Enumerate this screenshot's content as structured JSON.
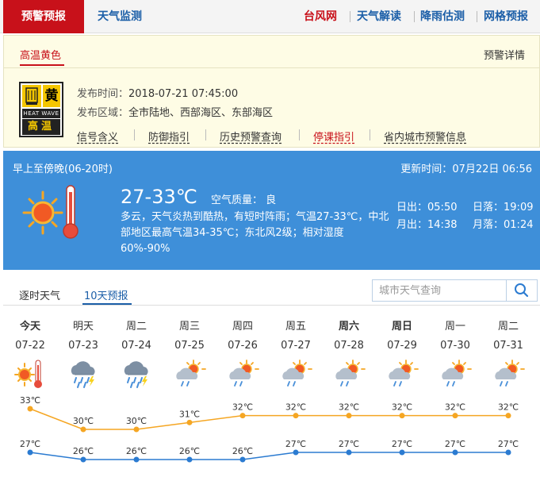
{
  "topbar": {
    "active_tab": "预警预报",
    "monitor_tab": "天气监测",
    "links": [
      "台风网",
      "天气解读",
      "降雨估测",
      "网格预报"
    ],
    "link_colors": [
      "#c8111a",
      "#1c5fa8",
      "#1c5fa8",
      "#1c5fa8"
    ]
  },
  "warning": {
    "title": "高温黄色",
    "detail_link": "预警详情",
    "badge": {
      "char": "黄",
      "en": "HEAT WAVE",
      "cn": "高温",
      "color": "#f4c600"
    },
    "publish_label": "发布时间：",
    "publish_time": "2018-07-21 07:45:00",
    "area_label": "发布区域：",
    "area": "全市陆地、西部海区、东部海区",
    "links": [
      "信号含义",
      "防御指引",
      "历史预警查询",
      "停课指引",
      "省内城市预警信息"
    ]
  },
  "today": {
    "period": "早上至傍晚(06-20时)",
    "update_label": "更新时间：",
    "update_time": "07月22日 06:56",
    "temp_range": "27-33℃",
    "aqi_label": "空气质量：",
    "aqi": "良",
    "description": "多云，天气炎热到酷热，有短时阵雨；气温27-33℃，中北部地区最高气温34-35℃；东北风2级；相对湿度60%-90%",
    "sunrise_label": "日出：",
    "sunrise": "05:50",
    "sunset_label": "日落：",
    "sunset": "19:09",
    "moonrise_label": "月出：",
    "moonrise": "14:38",
    "moonset_label": "月落：",
    "moonset": "01:24"
  },
  "forecast_tabs": {
    "hourly": "逐时天气",
    "ten_day": "10天预报"
  },
  "search": {
    "placeholder": "城市天气查询"
  },
  "days": [
    {
      "day": "今天",
      "date": "07-22",
      "icon": "heat-wave-icon",
      "bold": true
    },
    {
      "day": "明天",
      "date": "07-23",
      "icon": "thunderstorm-icon",
      "bold": false
    },
    {
      "day": "周二",
      "date": "07-24",
      "icon": "thunderstorm-icon",
      "bold": false
    },
    {
      "day": "周三",
      "date": "07-25",
      "icon": "partly-cloudy-rain-icon",
      "bold": false
    },
    {
      "day": "周四",
      "date": "07-26",
      "icon": "partly-cloudy-rain-icon",
      "bold": false
    },
    {
      "day": "周五",
      "date": "07-27",
      "icon": "partly-cloudy-rain-icon",
      "bold": false
    },
    {
      "day": "周六",
      "date": "07-28",
      "icon": "partly-cloudy-rain-icon",
      "bold": true
    },
    {
      "day": "周日",
      "date": "07-29",
      "icon": "partly-cloudy-rain-icon",
      "bold": true
    },
    {
      "day": "周一",
      "date": "07-30",
      "icon": "partly-cloudy-rain-icon",
      "bold": false
    },
    {
      "day": "周二",
      "date": "07-31",
      "icon": "partly-cloudy-rain-icon",
      "bold": false
    }
  ],
  "chart_data": {
    "type": "line",
    "categories": [
      "07-22",
      "07-23",
      "07-24",
      "07-25",
      "07-26",
      "07-27",
      "07-28",
      "07-29",
      "07-30",
      "07-31"
    ],
    "series": [
      {
        "values": [
          33,
          30,
          30,
          31,
          32,
          32,
          32,
          32,
          32,
          32
        ],
        "color": "#f5a623",
        "labels": [
          "33℃",
          "30℃",
          "30℃",
          "31℃",
          "32℃",
          "32℃",
          "32℃",
          "32℃",
          "32℃",
          "32℃"
        ]
      },
      {
        "values": [
          27,
          26,
          26,
          26,
          26,
          27,
          27,
          27,
          27,
          27
        ],
        "color": "#2b7bd1",
        "labels": [
          "27℃",
          "26℃",
          "26℃",
          "26℃",
          "26℃",
          "27℃",
          "27℃",
          "27℃",
          "27℃",
          "27℃"
        ]
      }
    ]
  }
}
